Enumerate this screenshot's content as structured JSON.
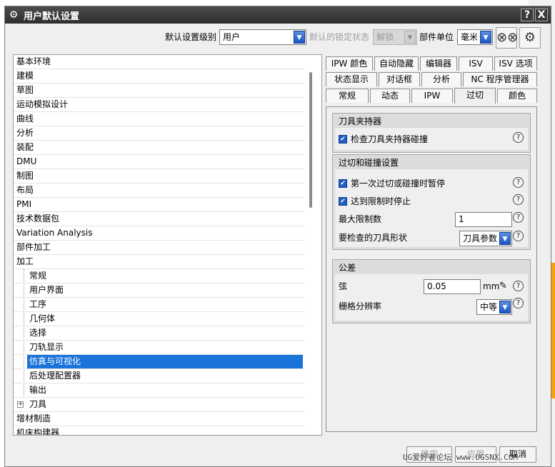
{
  "window": {
    "title": "用户默认设置"
  },
  "titlebar": {
    "help": "?",
    "close": "X"
  },
  "toolbar": {
    "level_label": "默认设置级别",
    "level_value": "用户",
    "lock_status_label": "默认的锁定状态",
    "lock_status_value": "解锁",
    "part_unit_label": "部件单位",
    "part_unit_value": "毫米"
  },
  "tree": {
    "items": [
      "基本环境",
      "建模",
      "草图",
      "运动模拟设计",
      "曲线",
      "分析",
      "装配",
      "DMU",
      "制图",
      "布局",
      "PMI",
      "技术数据包",
      "Variation Analysis",
      "部件加工",
      "加工"
    ],
    "children": [
      "常规",
      "用户界面",
      "工序",
      "几何体",
      "选择",
      "刀轨显示",
      "仿真与可视化",
      "后处理配置器",
      "输出",
      "刀具"
    ],
    "after": [
      "增材制造",
      "机床构建器"
    ]
  },
  "tabs": {
    "row1": [
      "IPW 颜色",
      "自动隐藏",
      "编辑器",
      "ISV",
      "ISV 选项"
    ],
    "row2": [
      "状态显示",
      "对话框",
      "分析",
      "NC 程序管理器"
    ],
    "row3": [
      "常规",
      "动态",
      "IPW",
      "过切",
      "颜色"
    ]
  },
  "group_holder": {
    "title": "刀具夹持器",
    "check_holder_collision": "检查刀具夹持器碰撞"
  },
  "group_gouge": {
    "title": "过切和碰撞设置",
    "pause_first": "第一次过切或碰撞时暂停",
    "stop_limit": "达到限制时停止",
    "max_limit_label": "最大限制数",
    "max_limit_value": "1",
    "tool_shape_label": "要检查的刀具形状",
    "tool_shape_value": "刀具参数"
  },
  "group_tolerance": {
    "title": "公差",
    "chord_label": "弦",
    "chord_value": "0.05",
    "chord_unit": "mm",
    "grid_label": "栅格分辨率",
    "grid_value": "中等"
  },
  "buttons": {
    "ok": "确定",
    "apply": "应用",
    "cancel": "取消"
  },
  "watermark": "UG爱好者论坛 www.UGSNX.COM"
}
